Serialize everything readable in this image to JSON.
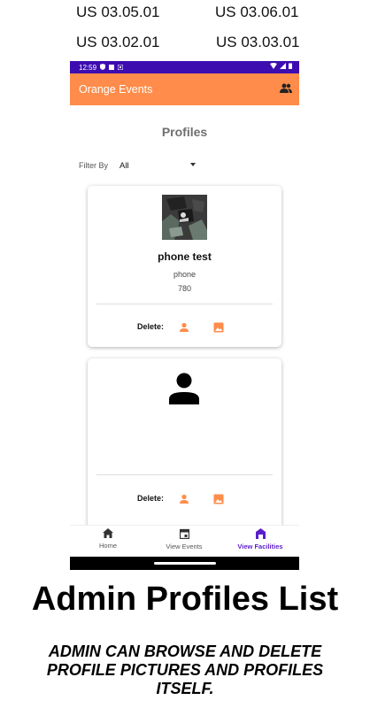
{
  "stories": [
    "US 03.05.01",
    "US 03.06.01",
    "US 03.02.01",
    "US 03.03.01"
  ],
  "status_bar": {
    "time": "12:59"
  },
  "app_bar": {
    "title": "Orange Events",
    "action_icon": "people-icon"
  },
  "page": {
    "heading": "Profiles",
    "filter_label": "Filter By",
    "filter_value": "All"
  },
  "profiles": [
    {
      "name": "phone test",
      "phone": "phone",
      "field2": "780",
      "delete_label": "Delete:",
      "has_photo": true
    },
    {
      "name": "",
      "phone": "",
      "field2": "",
      "delete_label": "Delete:",
      "has_photo": false
    }
  ],
  "bottom_nav": [
    {
      "label": "Home",
      "icon": "home-icon"
    },
    {
      "label": "View Events",
      "icon": "calendar-icon"
    },
    {
      "label": "View Facilities",
      "icon": "building-icon",
      "active": true
    }
  ],
  "caption": {
    "title": "Admin Profiles List",
    "description": "ADMIN CAN BROWSE AND DELETE PROFILE PICTURES AND PROFILES ITSELF."
  },
  "colors": {
    "accent": "#ff8c4a",
    "status_bar": "#3d0db0",
    "nav_active": "#5a1ecc"
  }
}
